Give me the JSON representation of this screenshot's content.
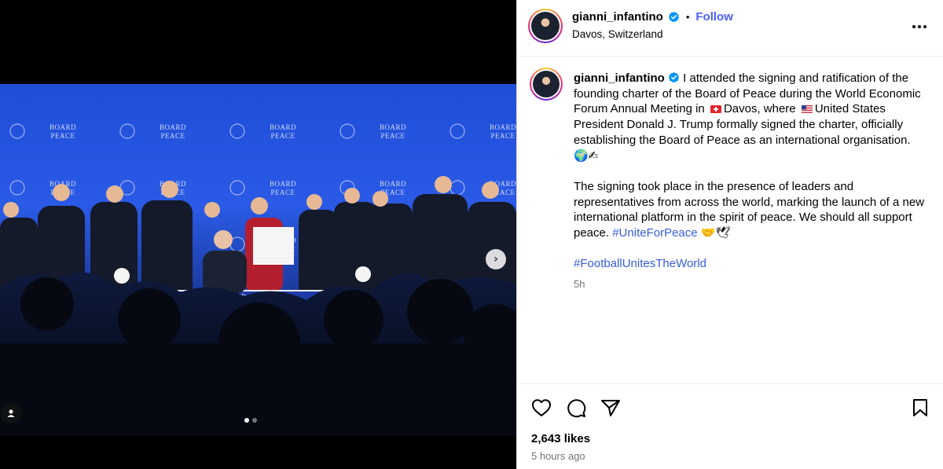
{
  "post": {
    "username": "gianni_infantino",
    "location": "Davos, Switzerland",
    "follow_label": "Follow",
    "separator": "•",
    "caption": {
      "part1": "I attended the signing and ratification of the founding charter of the Board of Peace during the World Economic Forum Annual Meeting in",
      "flag_ch": "swiss-flag-icon",
      "part2": "Davos, where",
      "flag_us": "us-flag-icon",
      "part3": "United States President Donald J. Trump formally signed the charter, officially establishing the Board of Peace as an international organisation.",
      "emoji1": "🌍✍",
      "paragraph2": "The signing took place in the presence of leaders and representatives from across the world, marking the launch of a new international platform in the spirit of peace. We should all support peace.",
      "hashtag1": "#UniteForPeace",
      "emoji2": "🤝🕊",
      "hashtag2": "#FootballUnitesTheWorld"
    },
    "relative_time": "5h",
    "likes": "2,643 likes",
    "timestamp": "5 hours ago",
    "carousel": {
      "count": 2,
      "active": 0
    },
    "photo_text": {
      "backdrop_brand": "BOARD OF PEACE",
      "table_banner": "BOARD of PEACE"
    }
  },
  "colors": {
    "link_blue": "#4a5df9",
    "hashtag_blue": "#385cdc",
    "verified_blue": "#0095f6",
    "muted_text": "#737373",
    "backdrop_blue": "#2a5ae6"
  }
}
